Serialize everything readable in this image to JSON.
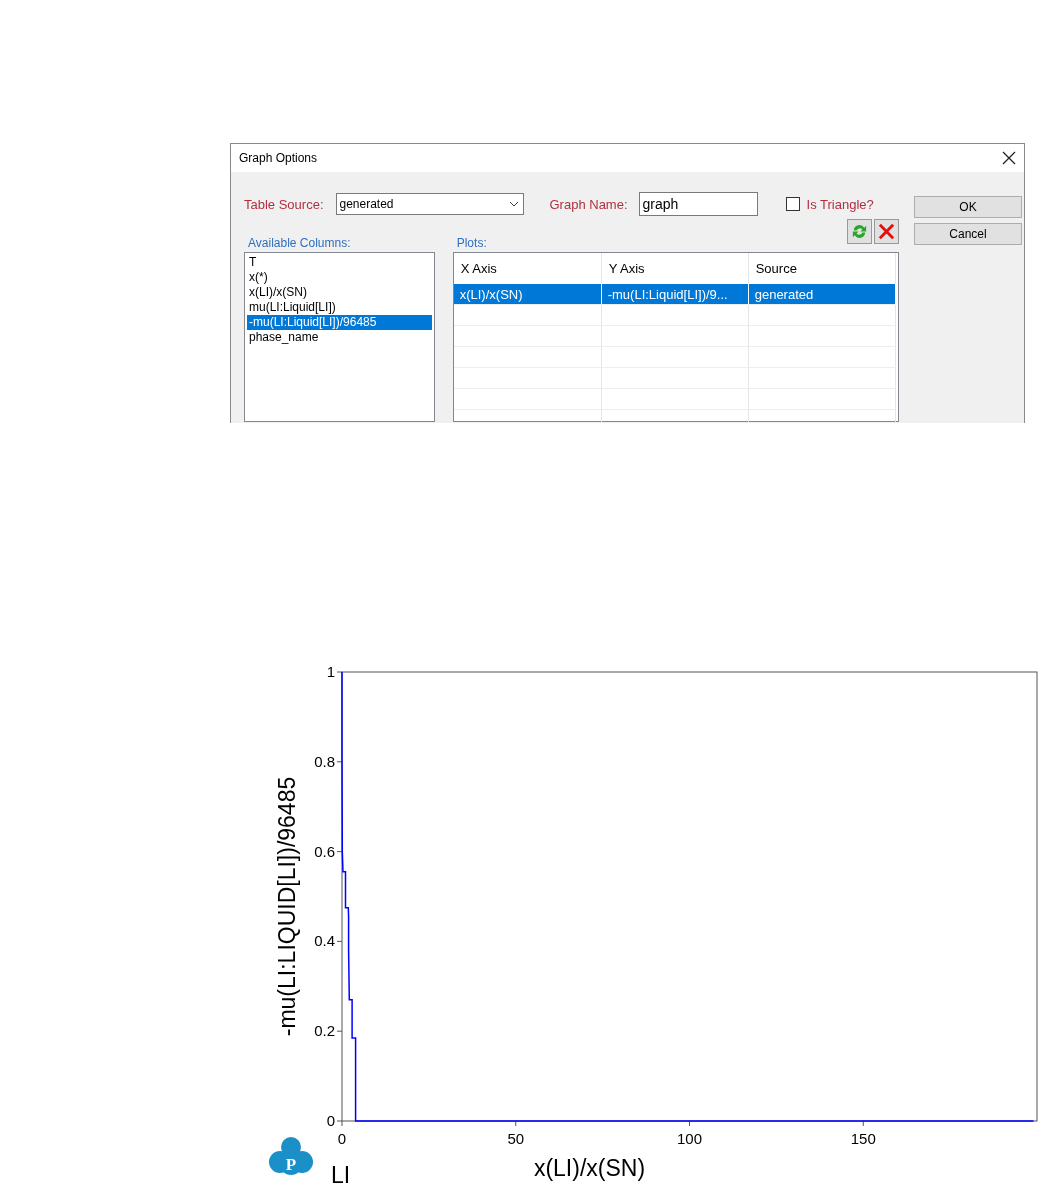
{
  "dialog": {
    "title": "Graph Options",
    "table_source": {
      "label": "Table Source:",
      "value": "generated"
    },
    "graph_name": {
      "label": "Graph Name:",
      "value": "graph"
    },
    "is_triangle": {
      "label": "Is Triangle?",
      "checked": false
    },
    "buttons": [
      "OK",
      "Cancel"
    ],
    "available_columns": {
      "label": "Available Columns:",
      "items": [
        {
          "text": "T",
          "selected": false
        },
        {
          "text": "x(*)",
          "selected": false
        },
        {
          "text": "x(LI)/x(SN)",
          "selected": false
        },
        {
          "text": "mu(LI:Liquid[LI])",
          "selected": false
        },
        {
          "text": "-mu(LI:Liquid[LI])/96485",
          "selected": true
        },
        {
          "text": "phase_name",
          "selected": false
        }
      ]
    },
    "plots": {
      "label": "Plots:",
      "columns": [
        "X Axis",
        "Y Axis",
        "Source"
      ],
      "rows": [
        {
          "cells": [
            "x(LI)/x(SN)",
            "-mu(LI:Liquid[LI])/9...",
            "generated"
          ],
          "selected": true
        }
      ]
    }
  },
  "graph": {
    "logo": {
      "text": "P"
    },
    "chart_data": {
      "type": "line",
      "xlabel": "x(LI)/x(SN)",
      "ylabel": "-mu(LI:LIQUID[LI])/96485",
      "x": [
        0,
        0,
        0.1,
        0.3,
        1.0,
        1.0,
        1.8,
        1.9,
        1.9,
        2.1,
        2.9,
        2.9,
        3.9,
        3.9,
        199
      ],
      "series": [
        {
          "name": "LI",
          "color": "#0000ff",
          "values": [
            1,
            0.8,
            0.6,
            0.555,
            0.555,
            0.475,
            0.475,
            0.455,
            0.38,
            0.27,
            0.27,
            0.185,
            0.185,
            0,
            0
          ]
        }
      ],
      "xlim": [
        0,
        200
      ],
      "ylim": [
        0,
        1
      ],
      "xticks": [
        0,
        50,
        100,
        150
      ],
      "yticks": [
        0,
        0.2,
        0.4,
        0.6,
        0.8,
        1
      ]
    }
  }
}
